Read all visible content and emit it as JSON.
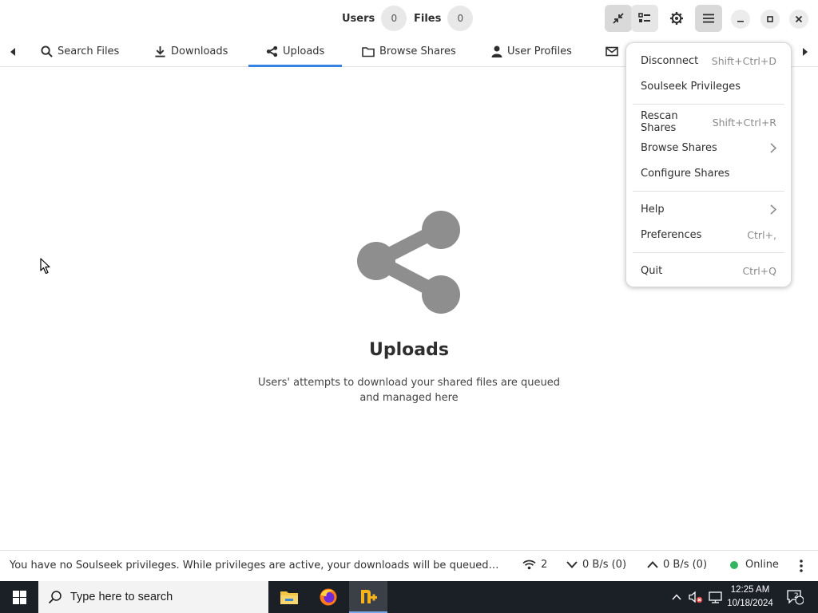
{
  "header": {
    "users_label": "Users",
    "users_count": "0",
    "files_label": "Files",
    "files_count": "0"
  },
  "tabs": [
    {
      "label": "Search Files",
      "icon": "search-icon"
    },
    {
      "label": "Downloads",
      "icon": "download-icon"
    },
    {
      "label": "Uploads",
      "icon": "share-icon",
      "selected": true
    },
    {
      "label": "Browse Shares",
      "icon": "folder-icon"
    },
    {
      "label": "User Profiles",
      "icon": "person-icon"
    },
    {
      "label": "",
      "icon": "mail-icon"
    }
  ],
  "empty_state": {
    "icon": "share-icon",
    "title": "Uploads",
    "description": "Users' attempts to download your shared files are queued and managed here"
  },
  "menu": {
    "items": [
      {
        "label": "Disconnect",
        "accel": "Shift+Ctrl+D"
      },
      {
        "label": "Soulseek Privileges",
        "accel": ""
      },
      {
        "label": "Rescan Shares",
        "accel": "Shift+Ctrl+R"
      },
      {
        "label": "Browse Shares",
        "accel": "",
        "submenu": true
      },
      {
        "label": "Configure Shares",
        "accel": ""
      },
      {
        "label": "Help",
        "accel": "",
        "submenu": true
      },
      {
        "label": "Preferences",
        "accel": "Ctrl+,"
      },
      {
        "label": "Quit",
        "accel": "Ctrl+Q"
      }
    ]
  },
  "statusbar": {
    "message": "You have no Soulseek privileges. While privileges are active, your downloads will be queued ahead of those of non-privileged users.",
    "connections": "2",
    "download_speed": "0 B/s (0)",
    "upload_speed": "0 B/s (0)",
    "status": "Online"
  },
  "taskbar": {
    "search_placeholder": "Type here to search",
    "time": "12:25 AM",
    "date": "10/18/2024",
    "notifications": "2"
  },
  "colors": {
    "accent": "#3584e4",
    "online": "#33b563",
    "icon_gray": "#8e8e8e",
    "taskbar": "#1b1f26"
  }
}
